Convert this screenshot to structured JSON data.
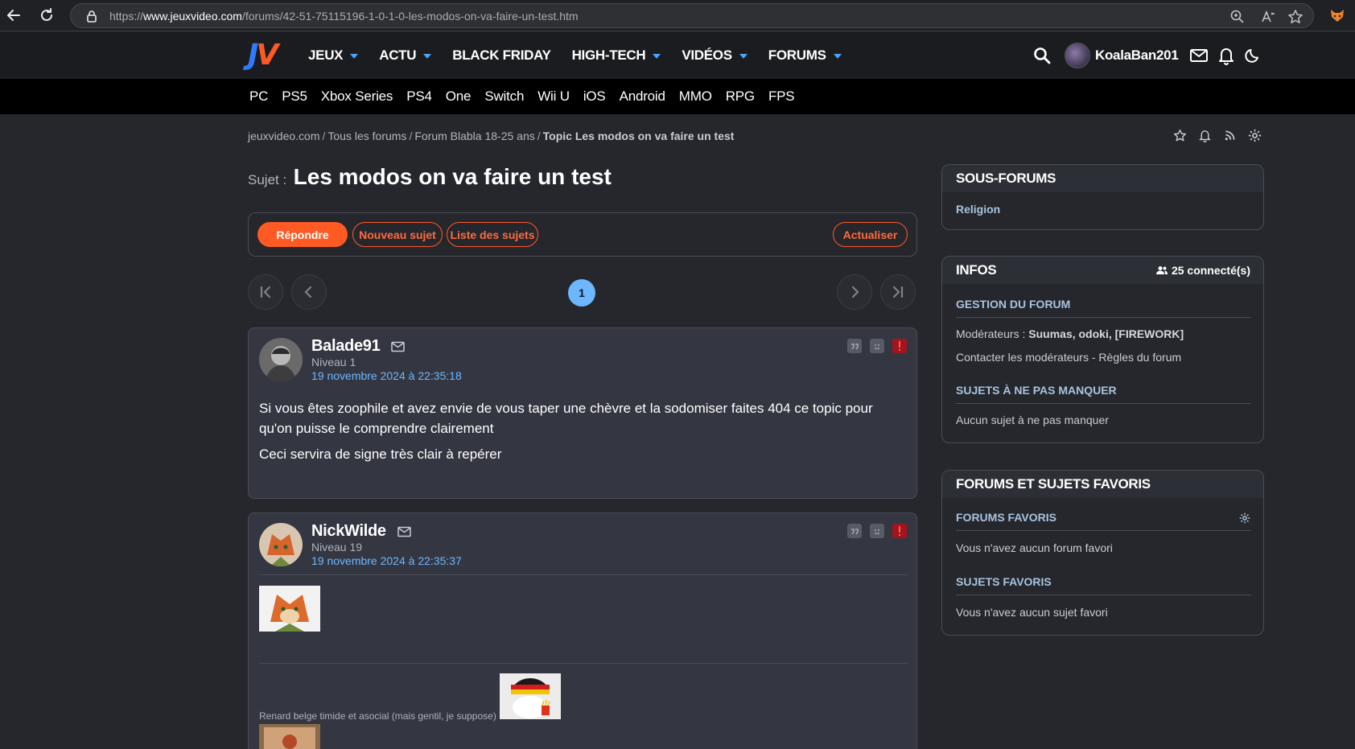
{
  "browser": {
    "url_prefix": "https://",
    "url_domain": "www.jeuxvideo.com",
    "url_path": "/forums/42-51-75115196-1-0-1-0-les-modos-on-va-faire-un-test.htm"
  },
  "brand": {
    "logo_j": "J",
    "logo_v": "V",
    "accent": "#ff5a24",
    "blue": "#2f7bff",
    "link": "#6db7ff"
  },
  "nav": {
    "items": [
      {
        "label": "JEUX",
        "dropdown": true
      },
      {
        "label": "ACTU",
        "dropdown": true
      },
      {
        "label": "BLACK FRIDAY",
        "dropdown": false
      },
      {
        "label": "HIGH-TECH",
        "dropdown": true
      },
      {
        "label": "VIDÉOS",
        "dropdown": true
      },
      {
        "label": "FORUMS",
        "dropdown": true
      }
    ],
    "username": "KoalaBan201"
  },
  "platforms": [
    "PC",
    "PS5",
    "Xbox Series",
    "PS4",
    "One",
    "Switch",
    "Wii U",
    "iOS",
    "Android",
    "MMO",
    "RPG",
    "FPS"
  ],
  "breadcrumb": {
    "items": [
      "jeuxvideo.com",
      "Tous les forums",
      "Forum Blabla 18-25 ans"
    ],
    "current": "Topic Les modos on va faire un test",
    "separator": "/"
  },
  "topic": {
    "label": "Sujet :",
    "title": "Les modos on va faire un test"
  },
  "actions": {
    "reply": "Répondre",
    "new_topic": "Nouveau sujet",
    "topic_list": "Liste des sujets",
    "refresh": "Actualiser"
  },
  "pagination": {
    "current": "1"
  },
  "posts": [
    {
      "author": "Balade91",
      "level": "Niveau 1",
      "date": "19 novembre 2024 à 22:35:18",
      "paragraphs": [
        "Si vous êtes zoophile et avez envie de vous taper une chèvre et la sodomiser faites 404 ce topic pour qu'on puisse le comprendre clairement",
        "Ceci servira de signe très clair à repérer"
      ]
    },
    {
      "author": "NickWilde",
      "level": "Niveau 19",
      "date": "19 novembre 2024 à 22:35:37",
      "signature": "Renard belge timide et asocial (mais gentil, je suppose)"
    }
  ],
  "sidebar": {
    "subforums": {
      "title": "SOUS-FORUMS",
      "items": [
        "Religion"
      ]
    },
    "infos": {
      "title": "INFOS",
      "connected": "25 connecté(s)",
      "management_title": "GESTION DU FORUM",
      "moderators_label": "Modérateurs :",
      "moderators": "Suumas, odoki, [FIREWORK]",
      "contact_link": "Contacter les modérateurs",
      "link_sep": " - ",
      "rules_link": "Règles du forum",
      "must_see_title": "SUJETS À NE PAS MANQUER",
      "must_see_empty": "Aucun sujet à ne pas manquer"
    },
    "favorites": {
      "title": "FORUMS ET SUJETS FAVORIS",
      "forums_title": "FORUMS FAVORIS",
      "forums_empty": "Vous n'avez aucun forum favori",
      "topics_title": "SUJETS FAVORIS",
      "topics_empty": "Vous n'avez aucun sujet favori"
    }
  }
}
